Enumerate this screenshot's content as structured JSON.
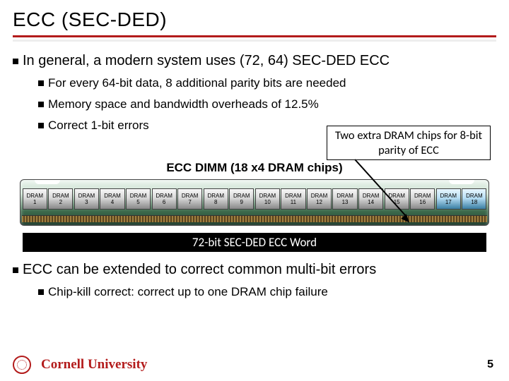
{
  "title": "ECC (SEC-DED)",
  "bullets": {
    "b1": "In general, a modern system uses (72, 64) SEC-DED ECC",
    "b1a": "For every 64-bit data, 8 additional parity bits are needed",
    "b1b": "Memory space and bandwidth overheads of 12.5%",
    "b1c": "Correct 1-bit errors",
    "b2": "ECC can be extended to correct common multi-bit errors",
    "b2a": "Chip-kill correct: correct up to one DRAM chip failure"
  },
  "callout": "Two extra DRAM chips for 8-bit parity of ECC",
  "dimm_title": "ECC DIMM (18 x4 DRAM chips)",
  "chip_label": "DRAM",
  "chips": [
    "1",
    "2",
    "3",
    "4",
    "5",
    "6",
    "7",
    "8",
    "9",
    "10",
    "11",
    "12",
    "13",
    "14",
    "15",
    "16",
    "17",
    "18"
  ],
  "ecc_word": "72-bit SEC-DED ECC Word",
  "university": "Cornell University",
  "pagenum": "5"
}
